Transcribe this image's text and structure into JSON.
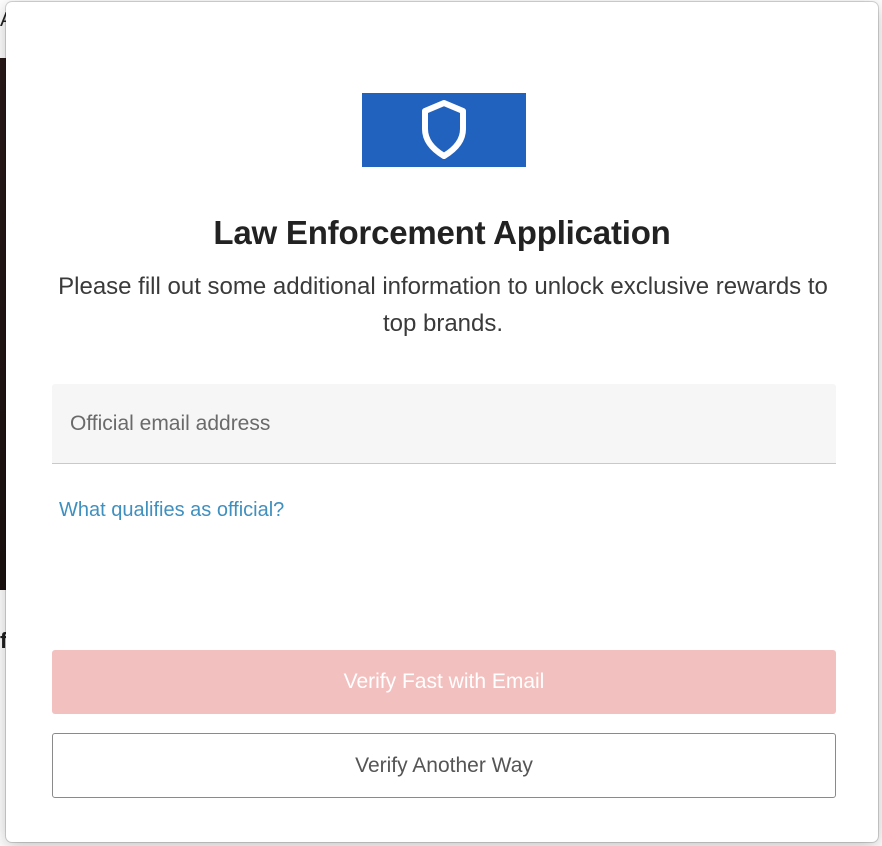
{
  "background": {
    "top_char": "A",
    "mid_char": "f"
  },
  "modal": {
    "logo": {
      "icon": "shield-icon",
      "bg_color": "#2162bf"
    },
    "title": "Law Enforcement Application",
    "subtitle": "Please fill out some additional information to unlock exclusive rewards to top brands.",
    "email_field": {
      "placeholder": "Official email address",
      "value": ""
    },
    "help_link": "What qualifies as official?",
    "primary_button": {
      "label": "Verify Fast with Email",
      "color": "#f2c1bf",
      "state": "disabled"
    },
    "secondary_button": {
      "label": "Verify Another Way"
    }
  },
  "colors": {
    "link": "#3f8fbf",
    "brand_blue": "#2162bf"
  }
}
